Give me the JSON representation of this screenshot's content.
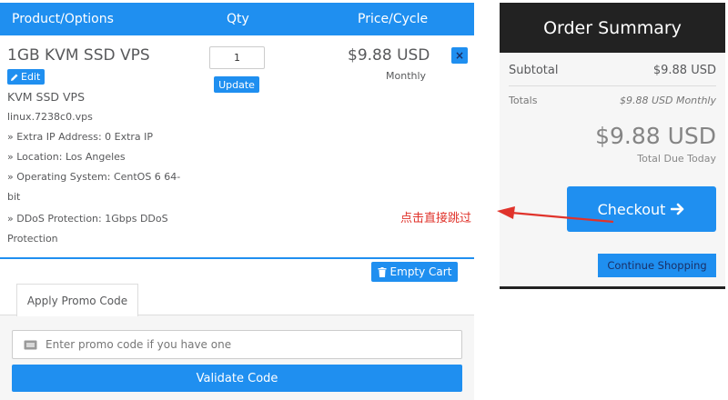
{
  "cart": {
    "headers": {
      "product": "Product/Options",
      "qty": "Qty",
      "price": "Price/Cycle"
    },
    "item": {
      "name": "1GB KVM SSD VPS",
      "edit_label": "Edit",
      "group": "KVM SSD VPS",
      "domain": "linux.7238c0.vps",
      "config": [
        "» Extra IP Address: 0 Extra IP",
        "» Location: Los Angeles",
        "» Operating System: CentOS 6 64-bit",
        "» DDoS Protection: 1Gbps DDoS Protection"
      ],
      "quantity": "1",
      "update_label": "Update",
      "price": "$9.88 USD",
      "cycle": "Monthly",
      "remove_label": "×"
    },
    "empty_cart_label": "Empty Cart"
  },
  "promo": {
    "tab_label": "Apply Promo Code",
    "placeholder": "Enter promo code if you have one",
    "validate_label": "Validate Code"
  },
  "summary": {
    "title": "Order Summary",
    "subtotal_label": "Subtotal",
    "subtotal_value": "$9.88 USD",
    "totals_label": "Totals",
    "totals_value": "$9.88 USD Monthly",
    "total_due": "$9.88 USD",
    "total_due_label": "Total Due Today",
    "checkout_label": "Checkout",
    "continue_label": "Continue Shopping"
  },
  "annotation": {
    "text": "点击直接跳过",
    "color": "#e0332b"
  },
  "colors": {
    "accent": "#1f8ff0",
    "dark": "#222222",
    "text": "#58595b"
  }
}
